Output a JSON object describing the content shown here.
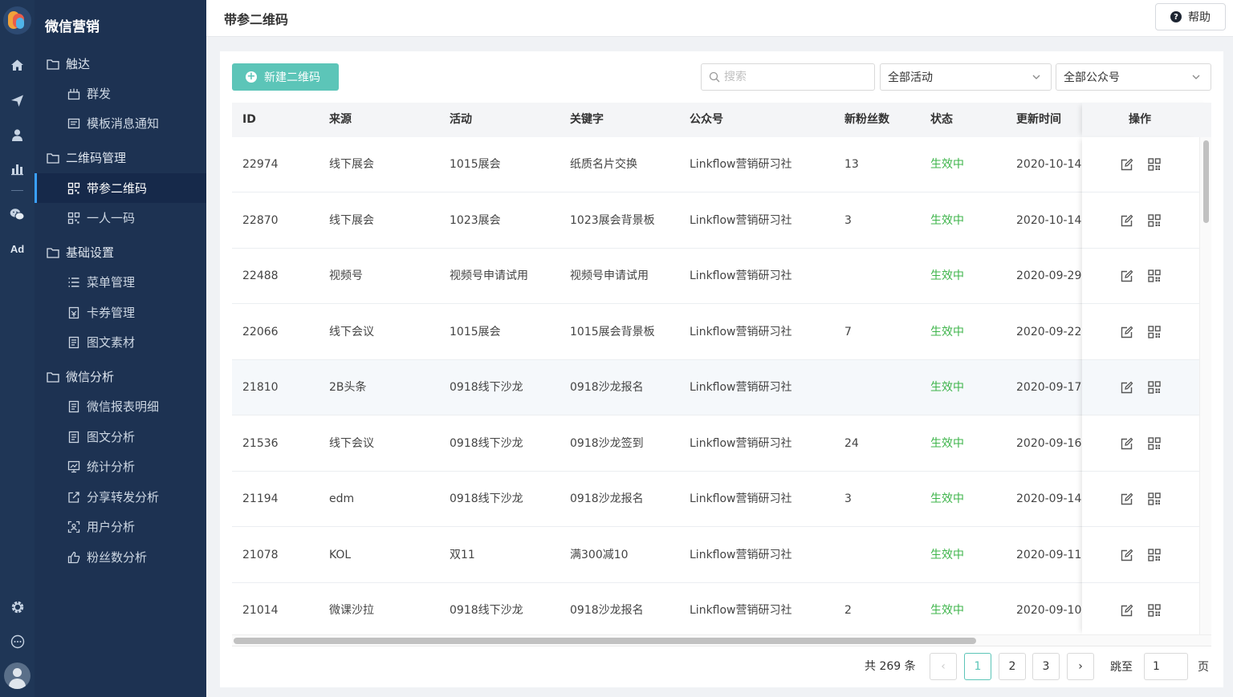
{
  "app": {
    "title": "微信营销"
  },
  "page": {
    "title": "带参二维码",
    "help_label": "帮助"
  },
  "rail_icons": [
    "home-icon",
    "send-icon",
    "user-icon",
    "bar-chart-icon",
    "wechat-icon",
    "ad-icon",
    "settings-icon",
    "chat-icon",
    "avatar"
  ],
  "rail_ad_label": "Ad",
  "sidebar": {
    "groups": [
      {
        "label": "触达",
        "items": [
          {
            "label": "群发"
          },
          {
            "label": "模板消息通知"
          }
        ]
      },
      {
        "label": "二维码管理",
        "items": [
          {
            "label": "带参二维码",
            "active": true
          },
          {
            "label": "一人一码"
          }
        ]
      },
      {
        "label": "基础设置",
        "items": [
          {
            "label": "菜单管理"
          },
          {
            "label": "卡券管理"
          },
          {
            "label": "图文素材"
          }
        ]
      },
      {
        "label": "微信分析",
        "items": [
          {
            "label": "微信报表明细"
          },
          {
            "label": "图文分析"
          },
          {
            "label": "统计分析"
          },
          {
            "label": "分享转发分析"
          },
          {
            "label": "用户分析"
          },
          {
            "label": "粉丝数分析"
          }
        ]
      }
    ]
  },
  "toolbar": {
    "new_label": "新建二维码",
    "search_placeholder": "搜索",
    "activity_select": "全部活动",
    "account_select": "全部公众号"
  },
  "table": {
    "columns": [
      "ID",
      "来源",
      "活动",
      "关键字",
      "公众号",
      "新粉丝数",
      "状态",
      "更新时间",
      "操作"
    ],
    "rows": [
      {
        "id": "22974",
        "source": "线下展会",
        "activity": "1015展会",
        "keyword": "纸质名片交换",
        "account": "Linkflow营销研习社",
        "fans": "13",
        "status": "生效中",
        "updated": "2020-10-14"
      },
      {
        "id": "22870",
        "source": "线下展会",
        "activity": "1023展会",
        "keyword": "1023展会背景板",
        "account": "Linkflow营销研习社",
        "fans": "3",
        "status": "生效中",
        "updated": "2020-10-14"
      },
      {
        "id": "22488",
        "source": "视频号",
        "activity": "视频号申请试用",
        "keyword": "视频号申请试用",
        "account": "Linkflow营销研习社",
        "fans": "",
        "status": "生效中",
        "updated": "2020-09-29"
      },
      {
        "id": "22066",
        "source": "线下会议",
        "activity": "1015展会",
        "keyword": "1015展会背景板",
        "account": "Linkflow营销研习社",
        "fans": "7",
        "status": "生效中",
        "updated": "2020-09-22"
      },
      {
        "id": "21810",
        "source": "2B头条",
        "activity": "0918线下沙龙",
        "keyword": "0918沙龙报名",
        "account": "Linkflow营销研习社",
        "fans": "",
        "status": "生效中",
        "updated": "2020-09-17"
      },
      {
        "id": "21536",
        "source": "线下会议",
        "activity": "0918线下沙龙",
        "keyword": "0918沙龙签到",
        "account": "Linkflow营销研习社",
        "fans": "24",
        "status": "生效中",
        "updated": "2020-09-16"
      },
      {
        "id": "21194",
        "source": "edm",
        "activity": "0918线下沙龙",
        "keyword": "0918沙龙报名",
        "account": "Linkflow营销研习社",
        "fans": "3",
        "status": "生效中",
        "updated": "2020-09-14"
      },
      {
        "id": "21078",
        "source": "KOL",
        "activity": "双11",
        "keyword": "满300减10",
        "account": "Linkflow营销研习社",
        "fans": "",
        "status": "生效中",
        "updated": "2020-09-11"
      },
      {
        "id": "21014",
        "source": "微课沙拉",
        "activity": "0918线下沙龙",
        "keyword": "0918沙龙报名",
        "account": "Linkflow营销研习社",
        "fans": "2",
        "status": "生效中",
        "updated": "2020-09-10"
      }
    ]
  },
  "pagination": {
    "total_text": "共 269 条",
    "prev": "‹",
    "next": "›",
    "pages": [
      "1",
      "2",
      "3"
    ],
    "current": "1",
    "jump_label": "跳至",
    "jump_value": "1",
    "page_suffix": "页"
  },
  "colors": {
    "accent": "#5cc5b8",
    "status": "#3db44a",
    "sidebar": "#1d3252",
    "rail": "#1f3656"
  }
}
